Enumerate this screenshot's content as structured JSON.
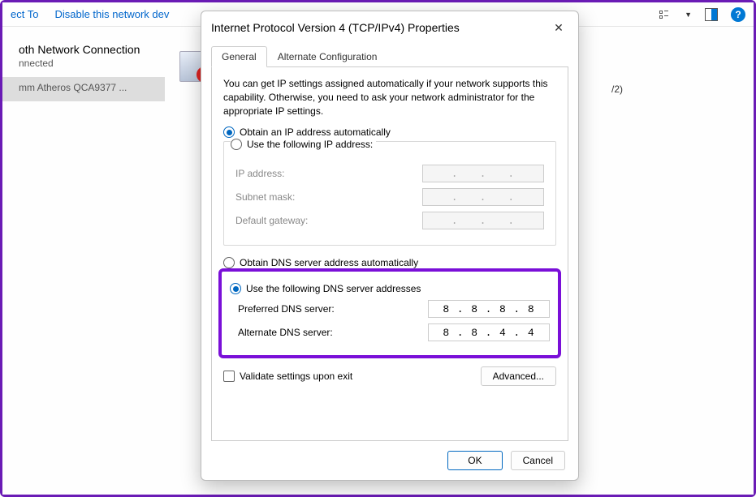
{
  "toolbar": {
    "connect_to": "ect To",
    "disable": "Disable this network dev"
  },
  "background": {
    "conn_title": "oth Network Connection",
    "conn_status": "nnected",
    "adapter_name": "mm Atheros QCA9377 ...",
    "trailing_text": "/2)"
  },
  "dialog": {
    "title": "Internet Protocol Version 4 (TCP/IPv4) Properties",
    "tabs": {
      "general": "General",
      "alt": "Alternate Configuration"
    },
    "desc": "You can get IP settings assigned automatically if your network supports this capability. Otherwise, you need to ask your network administrator for the appropriate IP settings.",
    "ip_auto": "Obtain an IP address automatically",
    "ip_manual": "Use the following IP address:",
    "ip_label": "IP address:",
    "subnet_label": "Subnet mask:",
    "gateway_label": "Default gateway:",
    "dns_auto": "Obtain DNS server address automatically",
    "dns_manual": "Use the following DNS server addresses",
    "pref_dns_label": "Preferred DNS server:",
    "alt_dns_label": "Alternate DNS server:",
    "pref_dns": [
      "8",
      "8",
      "8",
      "8"
    ],
    "alt_dns": [
      "8",
      "8",
      "4",
      "4"
    ],
    "validate": "Validate settings upon exit",
    "advanced": "Advanced...",
    "ok": "OK",
    "cancel": "Cancel"
  }
}
